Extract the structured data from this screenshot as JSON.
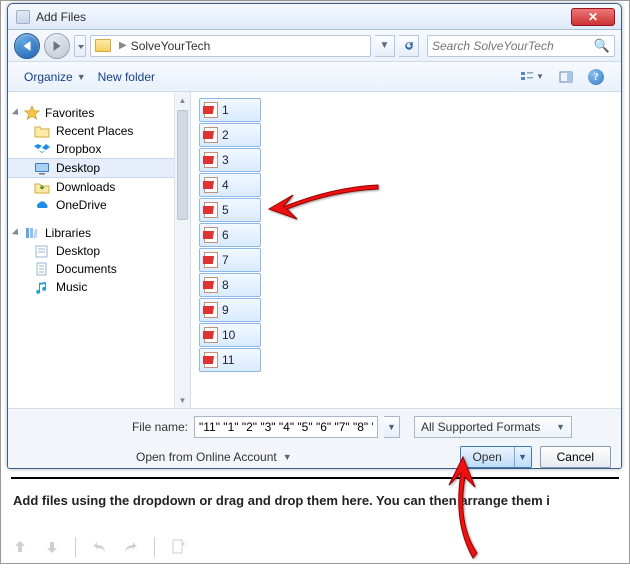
{
  "dialog": {
    "title": "Add Files",
    "path_folder": "SolveYourTech",
    "search_placeholder": "Search SolveYourTech",
    "organize_label": "Organize",
    "newfolder_label": "New folder",
    "filename_label": "File name:",
    "filename_value": "\"11\" \"1\" \"2\" \"3\" \"4\" \"5\" \"6\" \"7\" \"8\" '",
    "filter_label": "All Supported Formats",
    "online_label": "Open from Online Account",
    "open_label": "Open",
    "cancel_label": "Cancel"
  },
  "tree": {
    "favorites_label": "Favorites",
    "libraries_label": "Libraries",
    "fav_items": [
      {
        "label": "Recent Places"
      },
      {
        "label": "Dropbox"
      },
      {
        "label": "Desktop"
      },
      {
        "label": "Downloads"
      },
      {
        "label": "OneDrive"
      }
    ],
    "lib_items": [
      {
        "label": "Desktop"
      },
      {
        "label": "Documents"
      },
      {
        "label": "Music"
      }
    ]
  },
  "files": [
    {
      "name": "1"
    },
    {
      "name": "2"
    },
    {
      "name": "3"
    },
    {
      "name": "4"
    },
    {
      "name": "5"
    },
    {
      "name": "6"
    },
    {
      "name": "7"
    },
    {
      "name": "8"
    },
    {
      "name": "9"
    },
    {
      "name": "10"
    },
    {
      "name": "11"
    }
  ],
  "backdrop": {
    "msg": "Add files using the dropdown or drag and drop them here. You can then arrange them i"
  }
}
